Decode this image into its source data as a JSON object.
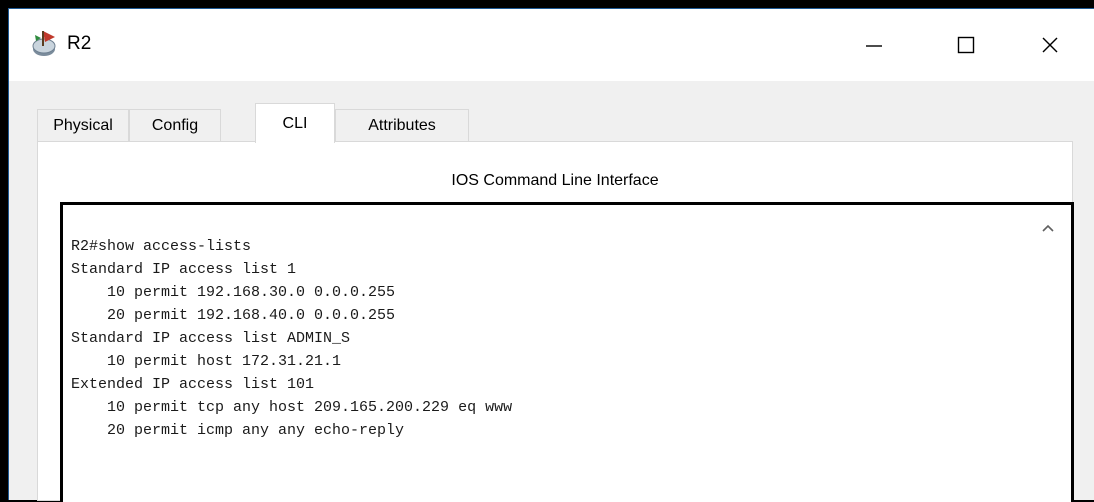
{
  "window": {
    "title": "R2",
    "icon": "router-icon"
  },
  "tabs": [
    {
      "label": "Physical",
      "active": false
    },
    {
      "label": "Config",
      "active": false
    },
    {
      "label": "CLI",
      "active": true
    },
    {
      "label": "Attributes",
      "active": false
    }
  ],
  "panel": {
    "title": "IOS Command Line Interface"
  },
  "terminal": {
    "lines": [
      "R2#show access-lists",
      "Standard IP access list 1",
      "    10 permit 192.168.30.0 0.0.0.255",
      "    20 permit 192.168.40.0 0.0.0.255",
      "Standard IP access list ADMIN_S",
      "    10 permit host 172.31.21.1",
      "Extended IP access list 101",
      "    10 permit tcp any host 209.165.200.229 eq www",
      "    20 permit icmp any any echo-reply"
    ]
  },
  "colors": {
    "window_border": "#1e5a96",
    "background": "#f0f0f0",
    "terminal_border": "#000000"
  }
}
